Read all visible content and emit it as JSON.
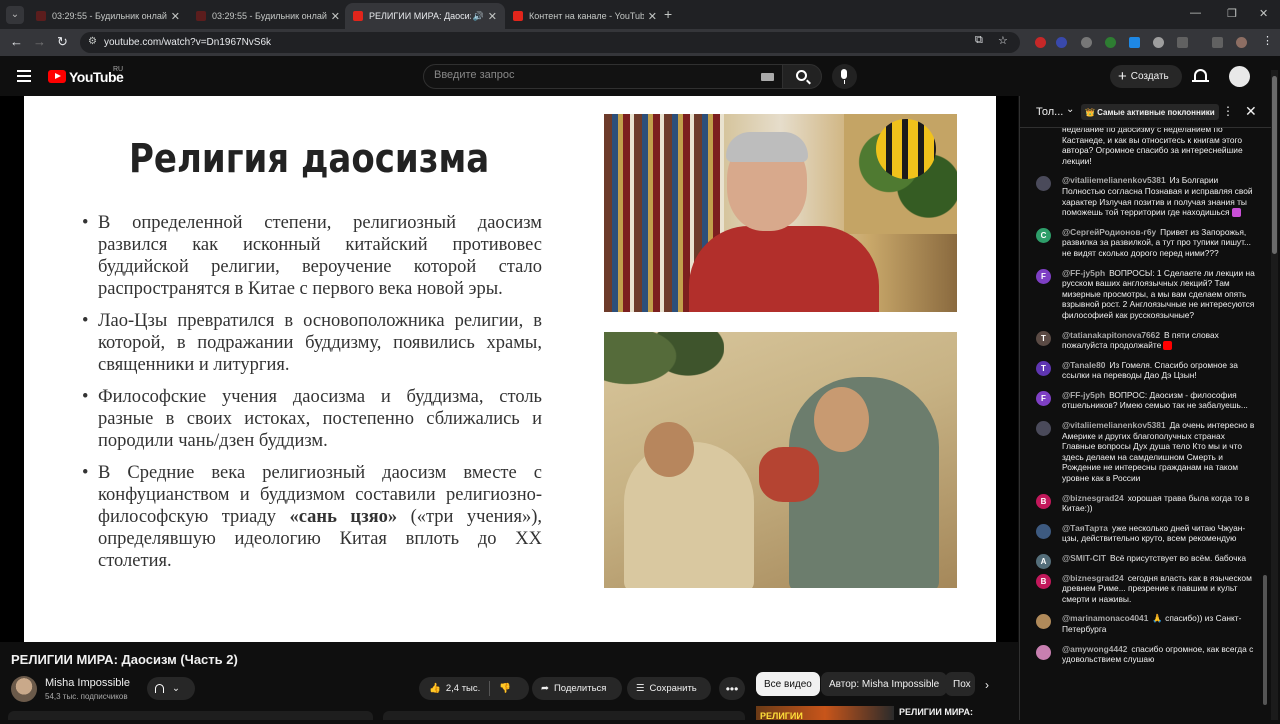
{
  "browser": {
    "tabs": [
      {
        "label": "03:29:55 - Будильник онлайн",
        "active": false
      },
      {
        "label": "03:29:55 - Будильник онлайн",
        "active": false
      },
      {
        "label": "РЕЛИГИИ МИРА: Даосизм",
        "active": true
      },
      {
        "label": "Контент на канале - YouTube S",
        "active": false
      }
    ],
    "url": "youtube.com/watch?v=Dn1967NvS6k"
  },
  "masthead": {
    "logo_text": "YouTube",
    "region": "RU",
    "search_placeholder": "Введите запрос",
    "create_label": "Создать"
  },
  "slide": {
    "title": "Религия даосизма",
    "bullets": [
      "В определенной степени, религиозный даосизм развился как исконный китайский противовес буддийской религии, вероучение которой стало распространятся в Китае с первого века новой эры.",
      "Лао-Цзы превратился в основоположника религии, в которой, в подражании буддизму, появились храмы, священники и литургия.",
      "Философские учения даосизма и буддизма, столь разные в своих истоках, постепенно сближались и породили чань/дзен буддизм."
    ],
    "bullet4_before": "В Средние века религиозный даосизм вместе с конфуцианством и буддизмом составили религиозно-философскую триаду ",
    "bullet4_bold": "«сань цзяо»",
    "bullet4_after": " («три учения»), определявшую идеологию Китая вплоть до XX столетия."
  },
  "video": {
    "title": "РЕЛИГИИ МИРА: Даосизм (Часть 2)",
    "channel": "Misha Impossible",
    "subscribers": "54,3 тыс. подписчиков",
    "likes": "2,4 тыс.",
    "share_label": "Поделиться",
    "save_label": "Сохранить",
    "more_label": "•••"
  },
  "chips": [
    {
      "label": "Все видео",
      "selected": true
    },
    {
      "label": "Автор: Misha Impossible",
      "selected": false
    },
    {
      "label": "Пох",
      "selected": false
    }
  ],
  "recommended": {
    "thumb_text": "РЕЛИГИИ",
    "title": "РЕЛИГИИ МИРА:"
  },
  "chat": {
    "mode_label": "Тол...",
    "badge_label": "👑 Самые активные поклонники",
    "messages": [
      {
        "author": "",
        "initial": "",
        "color": "#0f0f0f",
        "text": "неделание  по даосизму с  неделанием  по Кастанеде, и как вы относитесь к книгам этого автора? Огромное спасибо за интереснейшие лекции!",
        "emoji": ""
      },
      {
        "author": "@vitaliiemelianenkov5381",
        "initial": "",
        "color": "#4a4a5a",
        "text": "Из Болгарии Полностью согласна Познавая и исправляя свой характер Излучая позитив и получая знания ты поможешь той территории где находишься",
        "emoji": "#c94fd6"
      },
      {
        "author": "@СергейРодионов-г6у",
        "initial": "С",
        "color": "#2e9e6a",
        "text": "Привет из Запорожья, развилка за развилкой, а тут про тупики пишут... не видят сколько дорого перед ними???",
        "emoji": ""
      },
      {
        "author": "@FF-jy5ph",
        "initial": "F",
        "color": "#7e3fc4",
        "text": "ВОПРОСЫ: 1 Сделаете ли лекции на русском ваших англоязычных лекций? Там мизерные просмотры, а мы вам сделаем опять взрывной рост. 2 Англоязычные не интересуются философией как русскоязычные?",
        "emoji": ""
      },
      {
        "author": "@tatianakapitonova7662",
        "initial": "T",
        "color": "#5a4a44",
        "text": "В пяти словах пожалуйста продолжайте",
        "emoji": "#ff0000"
      },
      {
        "author": "@Tanale80",
        "initial": "T",
        "color": "#5e35b1",
        "text": "Из Гомеля. Спасибо огромное за ссылки на переводы Дао Дэ Цзын!",
        "emoji": ""
      },
      {
        "author": "@FF-jy5ph",
        "initial": "F",
        "color": "#7e3fc4",
        "text": "ВОПРОС: Даосизм - философия отшельников? Имею семью так не забалуешь...",
        "emoji": ""
      },
      {
        "author": "@vitaliiemelianenkov5381",
        "initial": "",
        "color": "#4a4a5a",
        "text": "Да очень интересно в Америке и других благополучных странах Главные вопросы Дух душа тело Кто мы и что здесь делаем на самделишном Смерть и Рождение не интересны гражданам на таком уровне как в России",
        "emoji": ""
      },
      {
        "author": "@biznesgrad24",
        "initial": "B",
        "color": "#c2185b",
        "text": "хорошая трава была когда то в Китае:))",
        "emoji": ""
      },
      {
        "author": "@ТаяТарта",
        "initial": "",
        "color": "#3d5a80",
        "text": "уже несколько дней читаю Чжуан-цзы, действительно круто, всем рекомендую",
        "emoji": ""
      },
      {
        "author": "@SMIT-CIT",
        "initial": "A",
        "color": "#546e7a",
        "text": "Всё присутствует во всём. бабочка",
        "emoji": ""
      },
      {
        "author": "@biznesgrad24",
        "initial": "B",
        "color": "#c2185b",
        "text": "сегодня власть как в языческом древнем Риме... презрение к павшим и культ смерти и наживы.",
        "emoji": ""
      },
      {
        "author": "@marinamonaco4041",
        "initial": "",
        "color": "#b08a5a",
        "text": "🙏 спасибо)) из Санкт-Петербурга",
        "emoji": ""
      },
      {
        "author": "@amywong4442",
        "initial": "",
        "color": "#c77fb0",
        "text": "спасибо огромное, как всегда с удовольствием слушаю",
        "emoji": ""
      }
    ]
  }
}
